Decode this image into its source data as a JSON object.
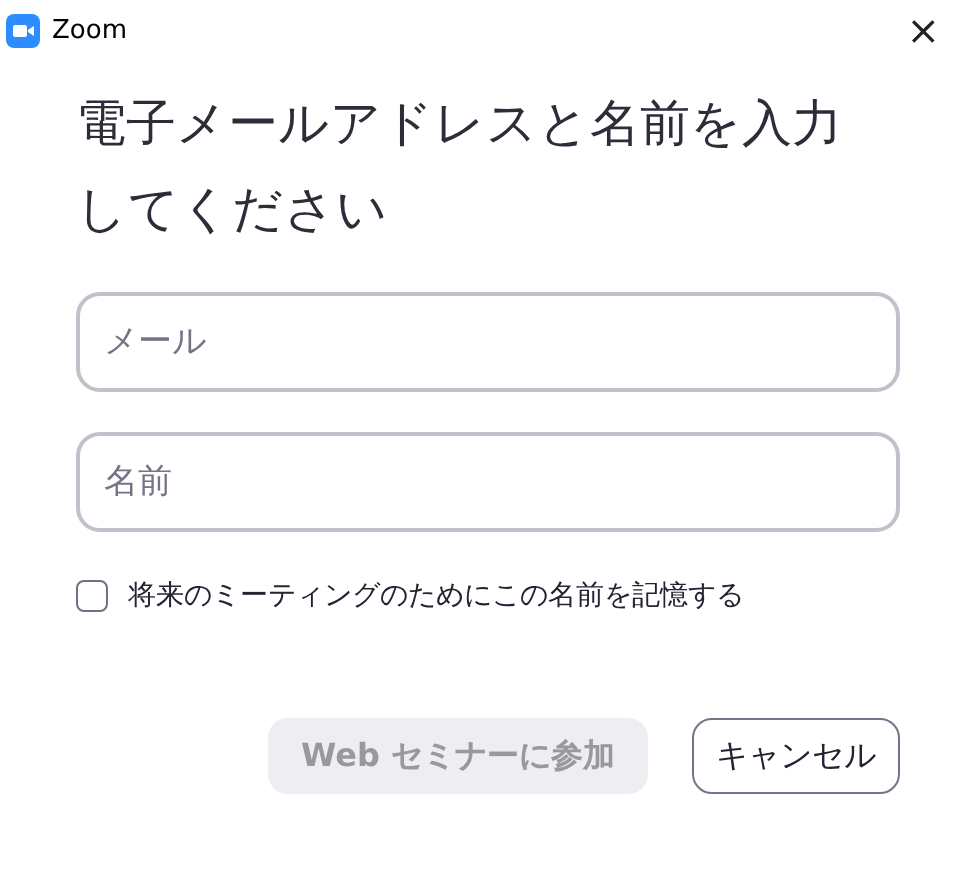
{
  "window": {
    "title": "Zoom",
    "close": "×"
  },
  "heading": "電子メールアドレスと名前を入力してください",
  "fields": [
    {
      "placeholder": "メール"
    },
    {
      "placeholder": "名前"
    }
  ],
  "remember": {
    "label": "将来のミーティングのためにこの名前を記憶する",
    "checked": false
  },
  "buttons": [
    {
      "label": "Web セミナーに参加",
      "disabled": true
    },
    {
      "label": "キャンセル",
      "disabled": false
    }
  ]
}
